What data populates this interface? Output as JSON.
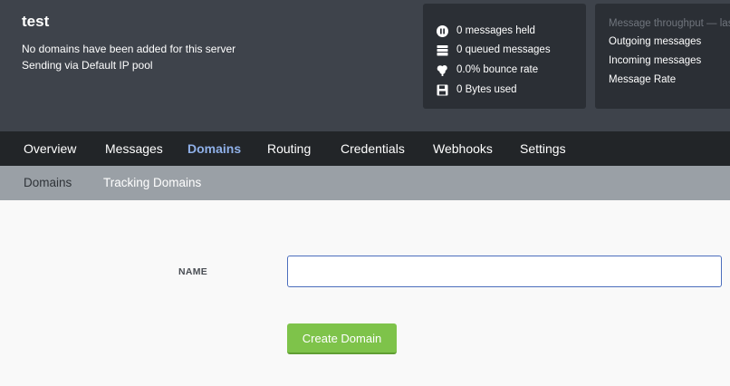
{
  "server": {
    "name": "test",
    "line1": "No domains have been added for this server",
    "line2": "Sending via Default IP pool"
  },
  "stats": [
    {
      "icon": "pause-icon",
      "label": "0 messages held"
    },
    {
      "icon": "queue-icon",
      "label": "0 queued messages"
    },
    {
      "icon": "bounce-icon",
      "label": "0.0% bounce rate"
    },
    {
      "icon": "save-icon",
      "label": "0 Bytes used"
    }
  ],
  "throughput": {
    "title": "Message throughput — las",
    "items": [
      "Outgoing messages",
      "Incoming messages",
      "Message Rate"
    ]
  },
  "nav": {
    "items": [
      "Overview",
      "Messages",
      "Domains",
      "Routing",
      "Credentials",
      "Webhooks",
      "Settings"
    ],
    "active": "Domains"
  },
  "subnav": {
    "items": [
      "Domains",
      "Tracking Domains"
    ],
    "active": "Domains"
  },
  "form": {
    "name_label": "NAME",
    "name_value": "",
    "submit_label": "Create Domain"
  },
  "colors": {
    "header_bg": "#3e434b",
    "nav_bg": "#222528",
    "subnav_bg": "#9aa0a6",
    "active_nav": "#8fb0e8",
    "button": "#7ec34a",
    "input_border": "#4c6ebd"
  }
}
